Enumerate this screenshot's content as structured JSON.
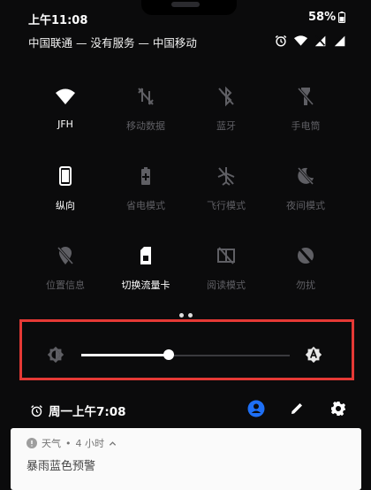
{
  "status_bar": {
    "time": "上午11:08",
    "battery": "58%",
    "carriers": "中国联通 — 没有服务 — 中国移动"
  },
  "tiles": [
    {
      "label": "JFH",
      "icon": "wifi-icon",
      "active": true
    },
    {
      "label": "移动数据",
      "icon": "mobile-data-off-icon",
      "active": false
    },
    {
      "label": "蓝牙",
      "icon": "bluetooth-off-icon",
      "active": false
    },
    {
      "label": "手电筒",
      "icon": "flashlight-off-icon",
      "active": false
    },
    {
      "label": "纵向",
      "icon": "portrait-icon",
      "active": true
    },
    {
      "label": "省电模式",
      "icon": "battery-saver-icon",
      "active": false
    },
    {
      "label": "飞行模式",
      "icon": "airplane-off-icon",
      "active": false
    },
    {
      "label": "夜间模式",
      "icon": "night-mode-off-icon",
      "active": false
    },
    {
      "label": "位置信息",
      "icon": "location-off-icon",
      "active": false
    },
    {
      "label": "切换流量卡",
      "icon": "sim-card-icon",
      "active": true
    },
    {
      "label": "阅读模式",
      "icon": "reading-mode-off-icon",
      "active": false
    },
    {
      "label": "勿扰",
      "icon": "do-not-disturb-off-icon",
      "active": false
    }
  ],
  "brightness": {
    "level": 0.42,
    "auto_icon": "auto-brightness-icon",
    "icon": "brightness-icon"
  },
  "alarm": {
    "label": "周一上午7:08",
    "icon": "alarm-icon"
  },
  "actions": [
    "user-icon",
    "edit-icon",
    "gear-icon"
  ],
  "notification": {
    "app": "天气",
    "time": "4 小时",
    "title": "暴雨蓝色预警"
  },
  "colors": {
    "background": "#0b0b0c",
    "inactive": "#5f5f64",
    "highlight_box": "#e53935",
    "accent": "#1e6ff5"
  }
}
